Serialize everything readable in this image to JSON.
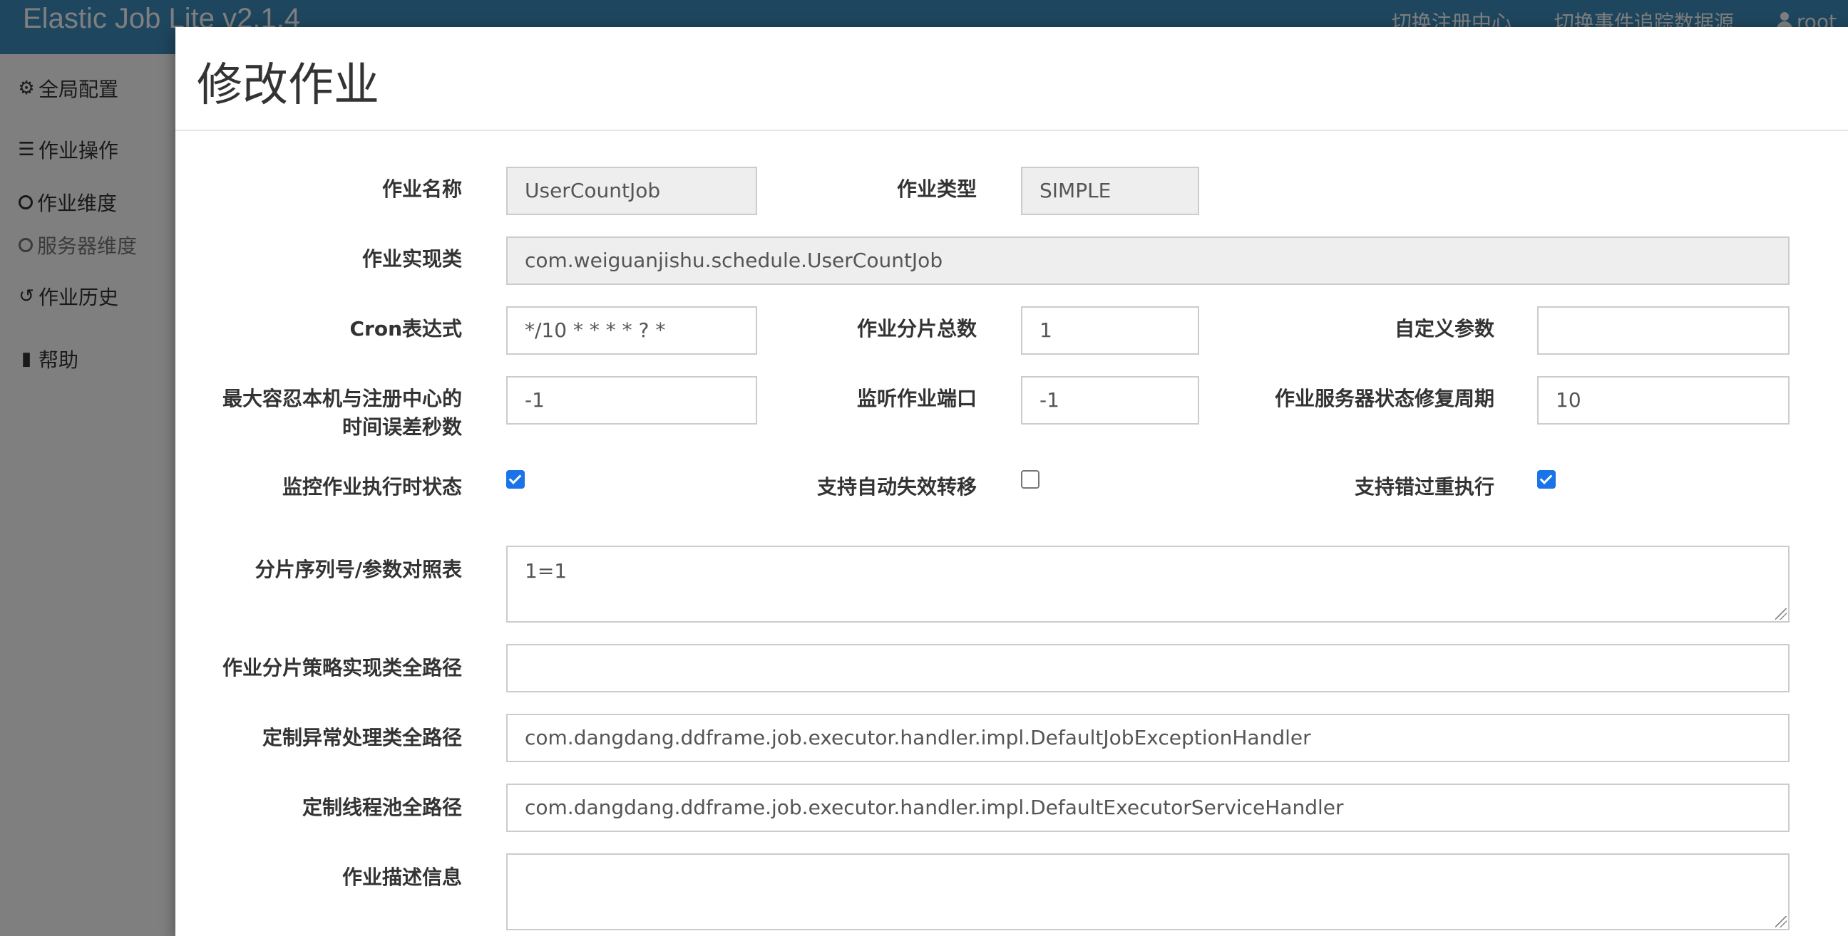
{
  "navbar": {
    "brand": "Elastic Job Lite v2.1.4",
    "links": [
      "切换注册中心",
      "切换事件追踪数据源",
      "root"
    ]
  },
  "sidebar": {
    "items": [
      {
        "icon": "gears-icon",
        "label": "全局配置"
      },
      {
        "icon": "tasks-icon",
        "label": "作业操作"
      },
      {
        "icon": "circle-icon",
        "label": "作业维度"
      },
      {
        "icon": "circle-icon",
        "label": "服务器维度"
      },
      {
        "icon": "history-icon",
        "label": "作业历史"
      },
      {
        "icon": "book-icon",
        "label": "帮助"
      }
    ]
  },
  "modal": {
    "title": "修改作业",
    "fields": {
      "job_name": {
        "label": "作业名称",
        "value": "UserCountJob"
      },
      "job_type": {
        "label": "作业类型",
        "value": "SIMPLE"
      },
      "job_class": {
        "label": "作业实现类",
        "value": "com.weiguanjishu.schedule.UserCountJob"
      },
      "cron": {
        "label": "Cron表达式",
        "value": "*/10 * * * * ? *"
      },
      "sharding_total": {
        "label": "作业分片总数",
        "value": "1"
      },
      "job_parameter": {
        "label": "自定义参数",
        "value": ""
      },
      "max_time_diff": {
        "label_line1": "最大容忍本机与注册中心的",
        "label_line2": "时间误差秒数",
        "value": "-1"
      },
      "monitor_port": {
        "label": "监听作业端口",
        "value": "-1"
      },
      "reconcile_interval": {
        "label": "作业服务器状态修复周期",
        "value": "10"
      },
      "monitor_execution": {
        "label": "监控作业执行时状态",
        "checked": true
      },
      "failover": {
        "label": "支持自动失效转移",
        "checked": false
      },
      "misfire": {
        "label": "支持错过重执行",
        "checked": true
      },
      "sharding_items": {
        "label": "分片序列号/参数对照表",
        "value": "1=1"
      },
      "strategy_class": {
        "label": "作业分片策略实现类全路径",
        "value": ""
      },
      "exception_handler": {
        "label": "定制异常处理类全路径",
        "value": "com.dangdang.ddframe.job.executor.handler.impl.DefaultJobExceptionHandler"
      },
      "executor_handler": {
        "label": "定制线程池全路径",
        "value": "com.dangdang.ddframe.job.executor.handler.impl.DefaultExecutorServiceHandler"
      },
      "description": {
        "label": "作业描述信息",
        "value": ""
      }
    }
  }
}
